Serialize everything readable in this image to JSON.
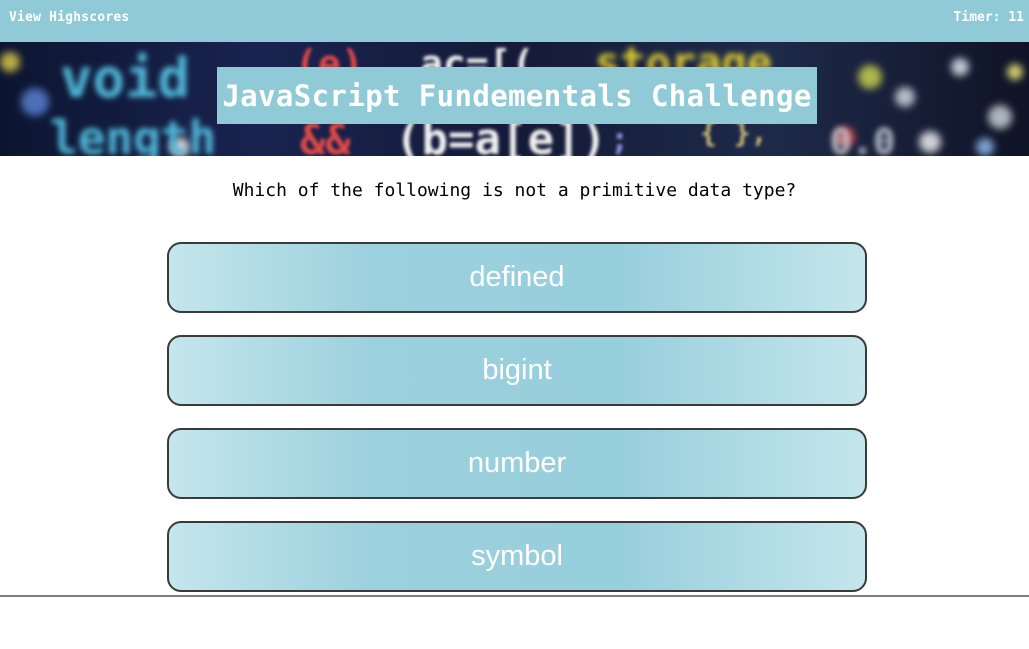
{
  "header": {
    "highscores_label": "View Highscores",
    "timer_label": "Timer:",
    "timer_value": "11"
  },
  "banner": {
    "title": "JavaScript Fundementals Challenge"
  },
  "quiz": {
    "question": "Which of the following is not a primitive data type?",
    "answers": [
      {
        "label": "defined"
      },
      {
        "label": "bigint"
      },
      {
        "label": "number"
      },
      {
        "label": "symbol"
      }
    ]
  },
  "colors": {
    "accent": "#90cad7",
    "answer_fill": "#9bd0dd",
    "answer_border": "#3a3a3a",
    "divider": "#808080"
  }
}
